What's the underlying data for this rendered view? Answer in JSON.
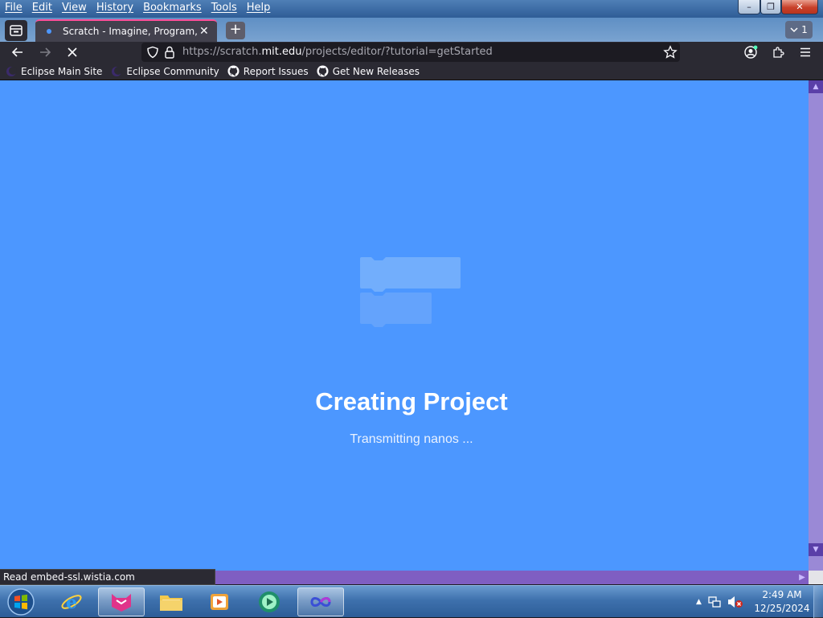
{
  "menubar": {
    "items": [
      {
        "label": "File"
      },
      {
        "label": "Edit"
      },
      {
        "label": "View"
      },
      {
        "label": "History"
      },
      {
        "label": "Bookmarks"
      },
      {
        "label": "Tools"
      },
      {
        "label": "Help"
      }
    ]
  },
  "window_controls": {
    "minimize": "–",
    "maximize": "❐",
    "close": "✕"
  },
  "tabs": {
    "active_title": "Scratch - Imagine, Program, Sha",
    "close_glyph": "✕",
    "new_tab_glyph": "+",
    "count": "1"
  },
  "navbar": {
    "url_prefix": "https://scratch.",
    "url_domain": "mit.edu",
    "url_suffix": "/projects/editor/?tutorial=getStarted"
  },
  "bookmarks": [
    {
      "label": "Eclipse Main Site",
      "icon": "eclipse-icon"
    },
    {
      "label": "Eclipse Community",
      "icon": "eclipse-icon"
    },
    {
      "label": "Report Issues",
      "icon": "github-icon"
    },
    {
      "label": "Get New Releases",
      "icon": "github-icon"
    }
  ],
  "content": {
    "heading": "Creating Project",
    "subtitle": "Transmitting nanos ...",
    "background": "#4c97ff"
  },
  "status": {
    "text": "Read embed-ssl.wistia.com"
  },
  "clock": {
    "time": "2:49 AM",
    "date": "12/25/2024"
  },
  "colors": {
    "tab_accent": "#ff4f9a",
    "scrollbar": "#9a89d6"
  }
}
